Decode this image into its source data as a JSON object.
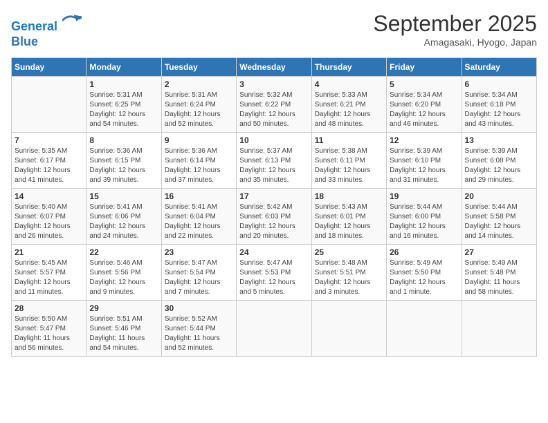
{
  "header": {
    "logo_line1": "General",
    "logo_line2": "Blue",
    "month": "September 2025",
    "location": "Amagasaki, Hyogo, Japan"
  },
  "weekdays": [
    "Sunday",
    "Monday",
    "Tuesday",
    "Wednesday",
    "Thursday",
    "Friday",
    "Saturday"
  ],
  "weeks": [
    [
      {
        "day": "",
        "info": ""
      },
      {
        "day": "1",
        "info": "Sunrise: 5:31 AM\nSunset: 6:25 PM\nDaylight: 12 hours\nand 54 minutes."
      },
      {
        "day": "2",
        "info": "Sunrise: 5:31 AM\nSunset: 6:24 PM\nDaylight: 12 hours\nand 52 minutes."
      },
      {
        "day": "3",
        "info": "Sunrise: 5:32 AM\nSunset: 6:22 PM\nDaylight: 12 hours\nand 50 minutes."
      },
      {
        "day": "4",
        "info": "Sunrise: 5:33 AM\nSunset: 6:21 PM\nDaylight: 12 hours\nand 48 minutes."
      },
      {
        "day": "5",
        "info": "Sunrise: 5:34 AM\nSunset: 6:20 PM\nDaylight: 12 hours\nand 46 minutes."
      },
      {
        "day": "6",
        "info": "Sunrise: 5:34 AM\nSunset: 6:18 PM\nDaylight: 12 hours\nand 43 minutes."
      }
    ],
    [
      {
        "day": "7",
        "info": "Sunrise: 5:35 AM\nSunset: 6:17 PM\nDaylight: 12 hours\nand 41 minutes."
      },
      {
        "day": "8",
        "info": "Sunrise: 5:36 AM\nSunset: 6:15 PM\nDaylight: 12 hours\nand 39 minutes."
      },
      {
        "day": "9",
        "info": "Sunrise: 5:36 AM\nSunset: 6:14 PM\nDaylight: 12 hours\nand 37 minutes."
      },
      {
        "day": "10",
        "info": "Sunrise: 5:37 AM\nSunset: 6:13 PM\nDaylight: 12 hours\nand 35 minutes."
      },
      {
        "day": "11",
        "info": "Sunrise: 5:38 AM\nSunset: 6:11 PM\nDaylight: 12 hours\nand 33 minutes."
      },
      {
        "day": "12",
        "info": "Sunrise: 5:39 AM\nSunset: 6:10 PM\nDaylight: 12 hours\nand 31 minutes."
      },
      {
        "day": "13",
        "info": "Sunrise: 5:39 AM\nSunset: 6:08 PM\nDaylight: 12 hours\nand 29 minutes."
      }
    ],
    [
      {
        "day": "14",
        "info": "Sunrise: 5:40 AM\nSunset: 6:07 PM\nDaylight: 12 hours\nand 26 minutes."
      },
      {
        "day": "15",
        "info": "Sunrise: 5:41 AM\nSunset: 6:06 PM\nDaylight: 12 hours\nand 24 minutes."
      },
      {
        "day": "16",
        "info": "Sunrise: 5:41 AM\nSunset: 6:04 PM\nDaylight: 12 hours\nand 22 minutes."
      },
      {
        "day": "17",
        "info": "Sunrise: 5:42 AM\nSunset: 6:03 PM\nDaylight: 12 hours\nand 20 minutes."
      },
      {
        "day": "18",
        "info": "Sunrise: 5:43 AM\nSunset: 6:01 PM\nDaylight: 12 hours\nand 18 minutes."
      },
      {
        "day": "19",
        "info": "Sunrise: 5:44 AM\nSunset: 6:00 PM\nDaylight: 12 hours\nand 16 minutes."
      },
      {
        "day": "20",
        "info": "Sunrise: 5:44 AM\nSunset: 5:58 PM\nDaylight: 12 hours\nand 14 minutes."
      }
    ],
    [
      {
        "day": "21",
        "info": "Sunrise: 5:45 AM\nSunset: 5:57 PM\nDaylight: 12 hours\nand 11 minutes."
      },
      {
        "day": "22",
        "info": "Sunrise: 5:46 AM\nSunset: 5:56 PM\nDaylight: 12 hours\nand 9 minutes."
      },
      {
        "day": "23",
        "info": "Sunrise: 5:47 AM\nSunset: 5:54 PM\nDaylight: 12 hours\nand 7 minutes."
      },
      {
        "day": "24",
        "info": "Sunrise: 5:47 AM\nSunset: 5:53 PM\nDaylight: 12 hours\nand 5 minutes."
      },
      {
        "day": "25",
        "info": "Sunrise: 5:48 AM\nSunset: 5:51 PM\nDaylight: 12 hours\nand 3 minutes."
      },
      {
        "day": "26",
        "info": "Sunrise: 5:49 AM\nSunset: 5:50 PM\nDaylight: 12 hours\nand 1 minute."
      },
      {
        "day": "27",
        "info": "Sunrise: 5:49 AM\nSunset: 5:48 PM\nDaylight: 11 hours\nand 58 minutes."
      }
    ],
    [
      {
        "day": "28",
        "info": "Sunrise: 5:50 AM\nSunset: 5:47 PM\nDaylight: 11 hours\nand 56 minutes."
      },
      {
        "day": "29",
        "info": "Sunrise: 5:51 AM\nSunset: 5:46 PM\nDaylight: 11 hours\nand 54 minutes."
      },
      {
        "day": "30",
        "info": "Sunrise: 5:52 AM\nSunset: 5:44 PM\nDaylight: 11 hours\nand 52 minutes."
      },
      {
        "day": "",
        "info": ""
      },
      {
        "day": "",
        "info": ""
      },
      {
        "day": "",
        "info": ""
      },
      {
        "day": "",
        "info": ""
      }
    ]
  ]
}
